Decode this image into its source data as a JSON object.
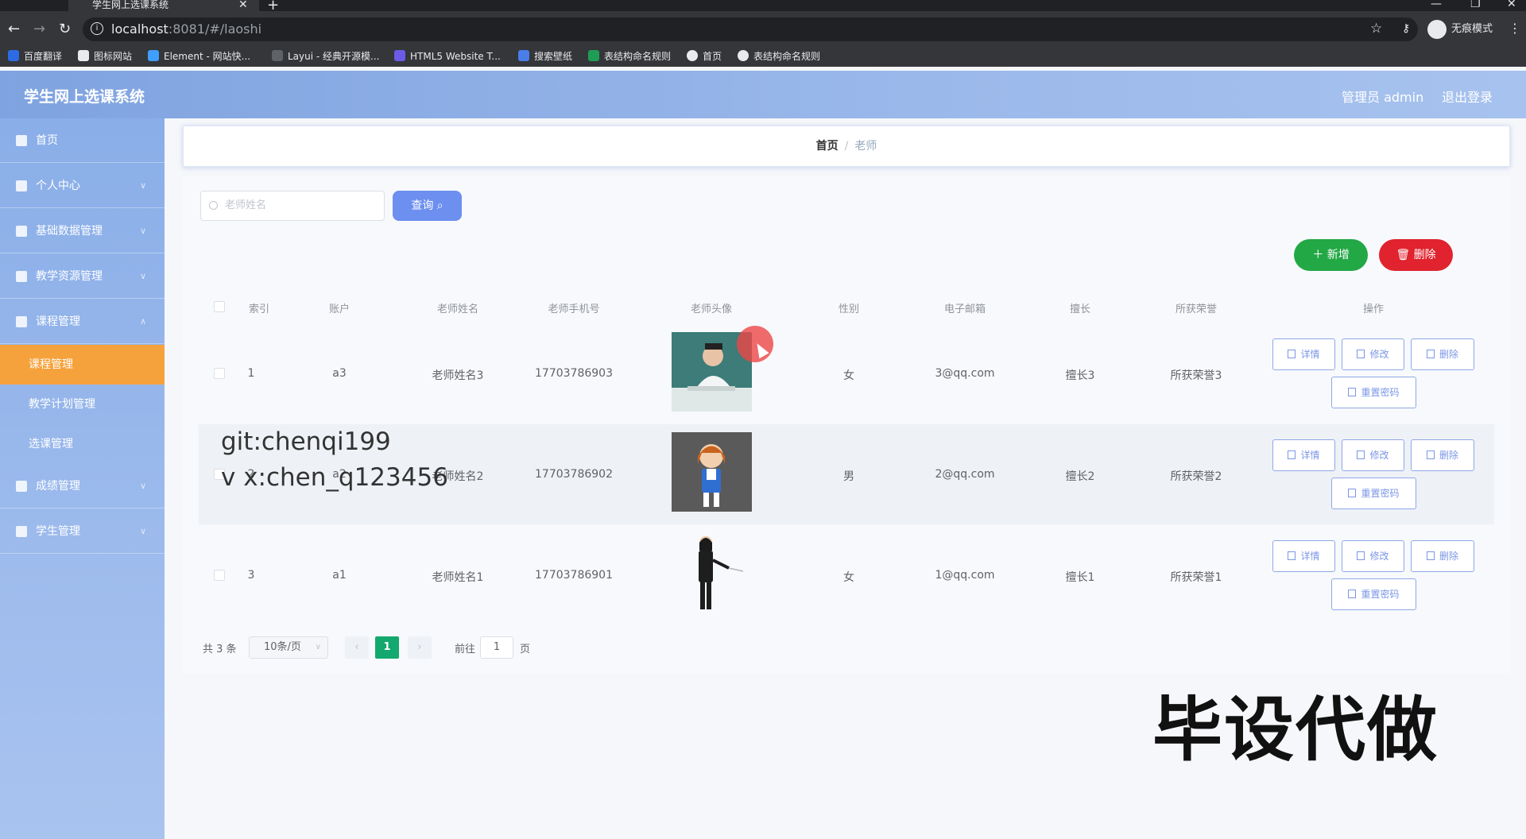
{
  "browser": {
    "tab_title": "学生网上选课系统",
    "url_host": "localhost",
    "url_path": ":8081/#/laoshi",
    "incognito_label": "无痕模式",
    "bookmarks": [
      "百度翻译",
      "图标网站",
      "Element - 网站快...",
      "Layui - 经典开源模...",
      "HTML5 Website T...",
      "搜索壁纸",
      "表结构命名规则",
      "首页",
      "表结构命名规则"
    ]
  },
  "header": {
    "title": "学生网上选课系统",
    "admin_label": "管理员 admin",
    "logout_label": "退出登录"
  },
  "sidebar": {
    "items": [
      {
        "label": "首页"
      },
      {
        "label": "个人中心"
      },
      {
        "label": "基础数据管理"
      },
      {
        "label": "教学资源管理"
      },
      {
        "label": "课程管理"
      },
      {
        "label": "成绩管理"
      },
      {
        "label": "学生管理"
      }
    ],
    "sub_items": [
      {
        "label": "课程管理",
        "active": true
      },
      {
        "label": "教学计划管理",
        "active": false
      },
      {
        "label": "选课管理",
        "active": false
      }
    ]
  },
  "breadcrumb": {
    "home": "首页",
    "separator": "/",
    "current": "老师"
  },
  "search": {
    "placeholder": "老师姓名",
    "query_label": "查询"
  },
  "actions": {
    "add_label": "新增",
    "delete_label": "删除"
  },
  "table": {
    "headers": [
      "索引",
      "账户",
      "老师姓名",
      "老师手机号",
      "老师头像",
      "性别",
      "电子邮箱",
      "擅长",
      "所获荣誉",
      "操作"
    ],
    "rows": [
      {
        "index": "1",
        "account": "a3",
        "name": "老师姓名3",
        "phone": "17703786903",
        "gender": "女",
        "email": "3@qq.com",
        "skill": "擅长3",
        "honor": "所获荣誉3"
      },
      {
        "index": "2",
        "account": "a2",
        "name": "老师姓名2",
        "phone": "17703786902",
        "gender": "男",
        "email": "2@qq.com",
        "skill": "擅长2",
        "honor": "所获荣誉2"
      },
      {
        "index": "3",
        "account": "a1",
        "name": "老师姓名1",
        "phone": "17703786901",
        "gender": "女",
        "email": "1@qq.com",
        "skill": "擅长1",
        "honor": "所获荣誉1"
      }
    ],
    "op_labels": {
      "detail": "详情",
      "edit": "修改",
      "delete": "删除",
      "reset": "重置密码"
    }
  },
  "pagination": {
    "total": "共 3 条",
    "page_size": "10条/页",
    "current_page": "1",
    "goto_label": "前往",
    "goto_value": "1",
    "page_suffix": "页"
  },
  "overlay": {
    "watermark_line1": "git:chenqi199",
    "watermark_line2": "v x:chen_q123456",
    "promo": "毕设代做"
  },
  "colors": {
    "primary": "#6d8ff0",
    "success": "#23a846",
    "danger": "#e0232e",
    "active_menu": "#f6a23c",
    "page_active": "#13a86d"
  }
}
